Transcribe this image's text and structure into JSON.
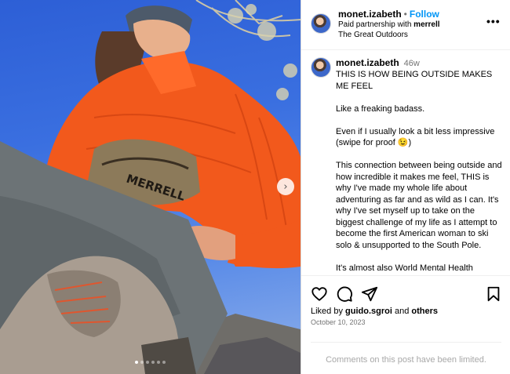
{
  "post": {
    "carousel": {
      "slide_count": 6,
      "active_index": 0
    }
  },
  "header": {
    "username": "monet.izabeth",
    "separator": "•",
    "follow_label": "Follow",
    "partnership_prefix": "Paid partnership with",
    "partner": "merrell",
    "location": "The Great Outdoors",
    "more_label": "•••"
  },
  "caption": {
    "username": "monet.izabeth",
    "time_ago": "46w",
    "paragraphs": [
      "THIS IS HOW BEING OUTSIDE MAKES ME FEEL",
      "Like a freaking badass.",
      "Even if I usually look a bit less impressive (swipe for proof 😉)",
      "This connection between being outside and how incredible it makes me feel, THIS is why I've made my whole life about adventuring as far and as wild as I can. It's why I've set myself up to take on the biggest challenge of my life as I attempt to become the first American woman to ski solo & unsupported to the South Pole.",
      "It's almost also World Mental Health"
    ]
  },
  "actions": {
    "liked_by_prefix": "Liked by",
    "liked_by_user": "guido.sgroi",
    "and": "and",
    "others": "others",
    "date": "October 10, 2023",
    "comments_limited": "Comments on this post have been limited."
  },
  "icons": {
    "heart": "heart-icon",
    "comment": "comment-icon",
    "share": "share-icon",
    "save": "bookmark-icon",
    "next": "chevron-right-icon",
    "more": "more-options-icon"
  },
  "colors": {
    "follow_blue": "#0095f6",
    "secondary_text": "#737373",
    "jacket_orange": "#f2591c",
    "sky_blue": "#3a6fe0"
  }
}
